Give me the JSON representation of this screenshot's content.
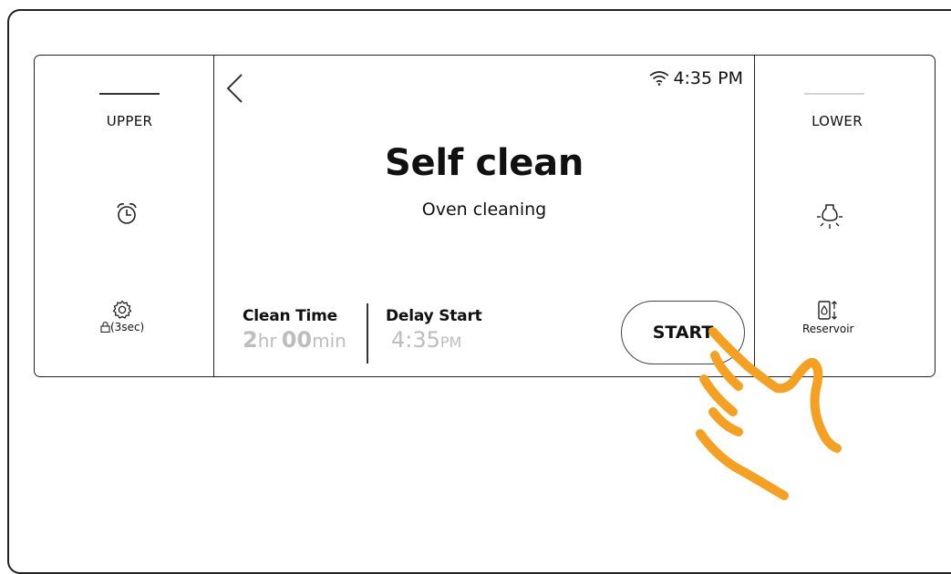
{
  "left_panel": {
    "oven_label": "UPPER",
    "lock_label": "(3sec)",
    "icons": [
      "alarm-clock-icon",
      "settings-gear-icon",
      "lock-icon"
    ]
  },
  "right_panel": {
    "oven_label": "LOWER",
    "reservoir_label": "Reservoir",
    "icons": [
      "oven-light-icon",
      "reservoir-icon"
    ]
  },
  "screen": {
    "time": "4:35 PM",
    "title": "Self clean",
    "subtitle": "Oven cleaning",
    "clean_time": {
      "label": "Clean Time",
      "hours": "2",
      "hours_unit": "hr",
      "minutes": "00",
      "minutes_unit": "min"
    },
    "delay_start": {
      "label": "Delay Start",
      "time": "4:35",
      "ampm": "PM"
    },
    "start_label": "START",
    "icons": [
      "back-chevron-icon",
      "wifi-icon"
    ]
  },
  "colors": {
    "accent_orange": "#F5A020",
    "dim_value_gray": "#BDBDBD"
  }
}
